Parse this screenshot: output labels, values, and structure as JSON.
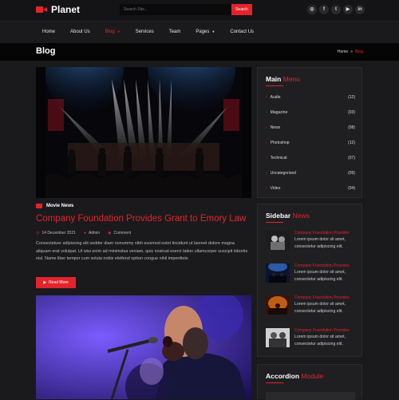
{
  "brand": {
    "name": "Planet"
  },
  "search": {
    "placeholder": "Search Site...",
    "button": "Search"
  },
  "socials": [
    "instagram-icon",
    "facebook-icon",
    "twitter-icon",
    "youtube-icon",
    "linkedin-icon"
  ],
  "social_glyphs": [
    "◎",
    "f",
    "t",
    "▶",
    "in"
  ],
  "nav": {
    "items": [
      {
        "label": "Home",
        "caret": ""
      },
      {
        "label": "About Us",
        "caret": ""
      },
      {
        "label": "Blog",
        "caret": "▼"
      },
      {
        "label": "Services",
        "caret": ""
      },
      {
        "label": "Team",
        "caret": ""
      },
      {
        "label": "Pages",
        "caret": "▼"
      },
      {
        "label": "Contact Us",
        "caret": ""
      }
    ]
  },
  "banner": {
    "title": "Blog",
    "crumb_home": "Home",
    "crumb_sep": "»",
    "crumb_current": "Blog"
  },
  "post": {
    "category": "Movie News",
    "title": "Company Foundation Provides Grant to Emory Law",
    "date": "14 December 2021",
    "author": "Admin",
    "comments": "Comment",
    "excerpt": "Consectetuer adipiscing elit sedder diam nonummy nibh euismod estot tincidunt ut laoreet dolore magna aliquam erat volutpat. Ut wisi enim ad minimstsa veniam, quis nostrud exerci tation ullamcorper suscipit lobortis nisl. Name liber tempor cum soluta nobis eleifend option congue nihil imperdiete",
    "read_more": "Read More"
  },
  "main_menu": {
    "title_white": "Main",
    "title_red": "Menu",
    "items": [
      {
        "label": "Audio",
        "count": "(12)"
      },
      {
        "label": "Magazine",
        "count": "(03)"
      },
      {
        "label": "News",
        "count": "(08)"
      },
      {
        "label": "Photoshop",
        "count": "(12)"
      },
      {
        "label": "Technical",
        "count": "(07)"
      },
      {
        "label": "Uncategorized",
        "count": "(09)"
      },
      {
        "label": "Video",
        "count": "(04)"
      }
    ]
  },
  "sidebar_news": {
    "title_white": "Sidebar",
    "title_red": "News",
    "items": [
      {
        "title": "Company Foundation Provides",
        "text": "Lorem ipsum dolor sit amet, consectetur adipiscing elit."
      },
      {
        "title": "Company Foundation Provides",
        "text": "Lorem ipsum dolor sit amet, consectetur adipiscing elit."
      },
      {
        "title": "Company Foundation Provides",
        "text": "Lorem ipsum dolor sit amet, consectetur adipiscing elit."
      },
      {
        "title": "Company Foundation Provides",
        "text": "Lorem ipsum dolor sit amet, consectetur adipiscing elit."
      }
    ]
  },
  "accordion": {
    "title_white": "Accordion",
    "title_red": "Module"
  },
  "colors": {
    "accent": "#e3242b",
    "background": "#1a1a1c",
    "topbar": "#141416",
    "banner": "#050505"
  }
}
